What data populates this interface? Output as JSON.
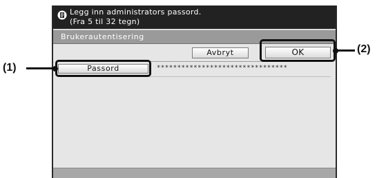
{
  "message": {
    "icon": "document-info-icon",
    "line1": "Legg inn administrators passord.",
    "line2": "(Fra 5 til 32 tegn)"
  },
  "title": "Brukerautentisering",
  "buttons": {
    "cancel_label": "Avbryt",
    "ok_label": "OK",
    "password_label": "Passord"
  },
  "password_value": "********************************",
  "callouts": {
    "one": "(1)",
    "two": "(2)"
  },
  "colors": {
    "message_bar": "#222222",
    "title_bar": "#9a9a9a",
    "panel": "#e6e6e6"
  }
}
